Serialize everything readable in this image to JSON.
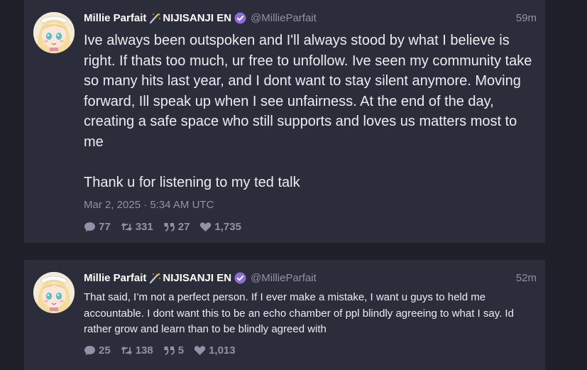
{
  "tweets": [
    {
      "display_name": "Millie Parfait",
      "affiliation": "NIJISANJI EN",
      "handle": "@MillieParfait",
      "relative_time": "59m",
      "text": "Ive always been outspoken and I'll always stood by what I believe is right. If thats too much, ur free to unfollow. Ive seen my community take so many hits last year, and I dont want to stay silent anymore. Moving forward, Ill speak up when I see unfairness. At the end of the day, creating a safe space who still supports and loves us matters most to me\n\nThank u for listening to my ted talk",
      "date": "Mar 2, 2025 · 5:34 AM UTC",
      "replies": "77",
      "retweets": "331",
      "quotes": "27",
      "likes": "1,735"
    },
    {
      "display_name": "Millie Parfait",
      "affiliation": "NIJISANJI EN",
      "handle": "@MillieParfait",
      "relative_time": "52m",
      "text": "That said, I’m not a perfect person. If I ever make a mistake, I want u guys to held me accountable. I dont want this to be an echo chamber of ppl blindly agreeing to what I say. Id rather grow and learn than to be blindly agreed with",
      "replies": "25",
      "retweets": "138",
      "quotes": "5",
      "likes": "1,013"
    }
  ],
  "icons": {
    "wand": "magic-wand-icon",
    "verified": "verified-badge-icon",
    "reply": "comment-icon",
    "retweet": "retweet-icon",
    "quote": "quote-icon",
    "like": "heart-icon"
  },
  "colors": {
    "background": "#1e1f28",
    "card": "#2c2d3b",
    "muted": "#8f92a8",
    "verified": "#8c6bd6"
  }
}
